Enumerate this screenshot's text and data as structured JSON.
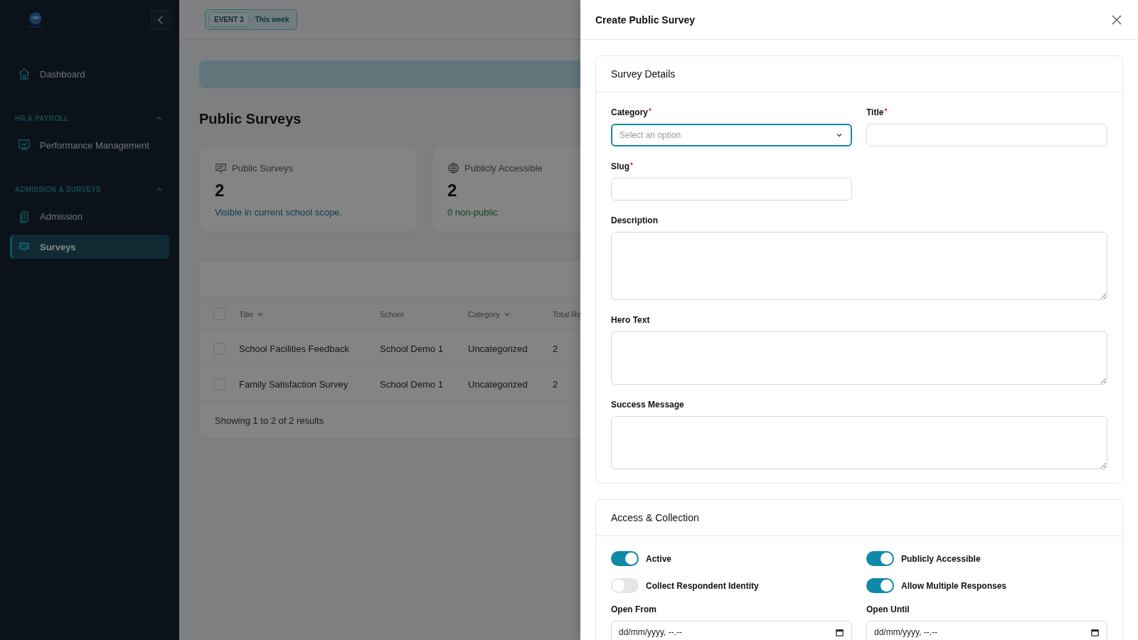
{
  "sidebar": {
    "nav": [
      {
        "label": "Dashboard",
        "kind": "home",
        "selected": false
      }
    ],
    "sections": [
      {
        "heading": "HR & PAYROLL",
        "expanded": true,
        "items": [
          {
            "label": "Performance Management",
            "kind": "chart",
            "selected": false
          }
        ]
      },
      {
        "heading": "ADMISSION & SURVEYS",
        "expanded": true,
        "items": [
          {
            "label": "Admission",
            "kind": "clipboard",
            "selected": false
          },
          {
            "label": "Surveys",
            "kind": "chat",
            "selected": true
          }
        ]
      }
    ]
  },
  "topbar": {
    "badge": {
      "event": "EVENT 3",
      "period": "This week"
    }
  },
  "page": {
    "title": "Public Surveys",
    "stats": [
      {
        "kind": "chat",
        "label": "Public Surveys",
        "value": "2",
        "note": "Visible in current school scope."
      },
      {
        "kind": "globe",
        "label": "Publicly Accessible",
        "value": "2",
        "note": "0 non-public"
      }
    ],
    "table": {
      "select_all": {
        "checked": false
      },
      "columns": [
        {
          "label": "Title",
          "sortable": true
        },
        {
          "label": "School",
          "sortable": false
        },
        {
          "label": "Category",
          "sortable": true
        },
        {
          "label": "Total Re",
          "sortable": false
        }
      ],
      "rows": [
        {
          "checked": false,
          "cells": [
            "School Facilities Feedback",
            "School Demo 1",
            "Uncategorized",
            "2"
          ]
        },
        {
          "checked": false,
          "cells": [
            "Family Satisfaction Survey",
            "School Demo 1",
            "Uncategorized",
            "2"
          ]
        }
      ],
      "footer": "Showing 1 to 2 of 2 results"
    }
  },
  "drawer": {
    "title": "Create Public Survey",
    "details": {
      "title": "Survey Details",
      "fields": [
        {
          "kind": "select",
          "label": "Category",
          "required_mark": "*",
          "placeholder": "Select an option",
          "focused": true
        },
        {
          "kind": "text",
          "label": "Title",
          "required_mark": "*",
          "focused": false
        },
        {
          "kind": "text",
          "label": "Slug",
          "required_mark": "*",
          "focused": false
        },
        {
          "kind": "textarea",
          "label": "Description",
          "focused": false
        },
        {
          "kind": "textarea",
          "label": "Hero Text",
          "focused": false
        },
        {
          "kind": "textarea",
          "label": "Success Message",
          "focused": false
        }
      ]
    },
    "access": {
      "title": "Access & Collection",
      "toggles": [
        {
          "label": "Active",
          "on": true
        },
        {
          "label": "Publicly Accessible",
          "on": true
        },
        {
          "label": "Collect Respondent Identity",
          "on": false
        },
        {
          "label": "Allow Multiple Responses",
          "on": true
        }
      ],
      "dates": [
        {
          "label": "Open From",
          "placeholder": "dd/mm/yyyy, --.--"
        },
        {
          "label": "Open Until",
          "placeholder": "dd/mm/yyyy, --.--"
        }
      ]
    }
  }
}
